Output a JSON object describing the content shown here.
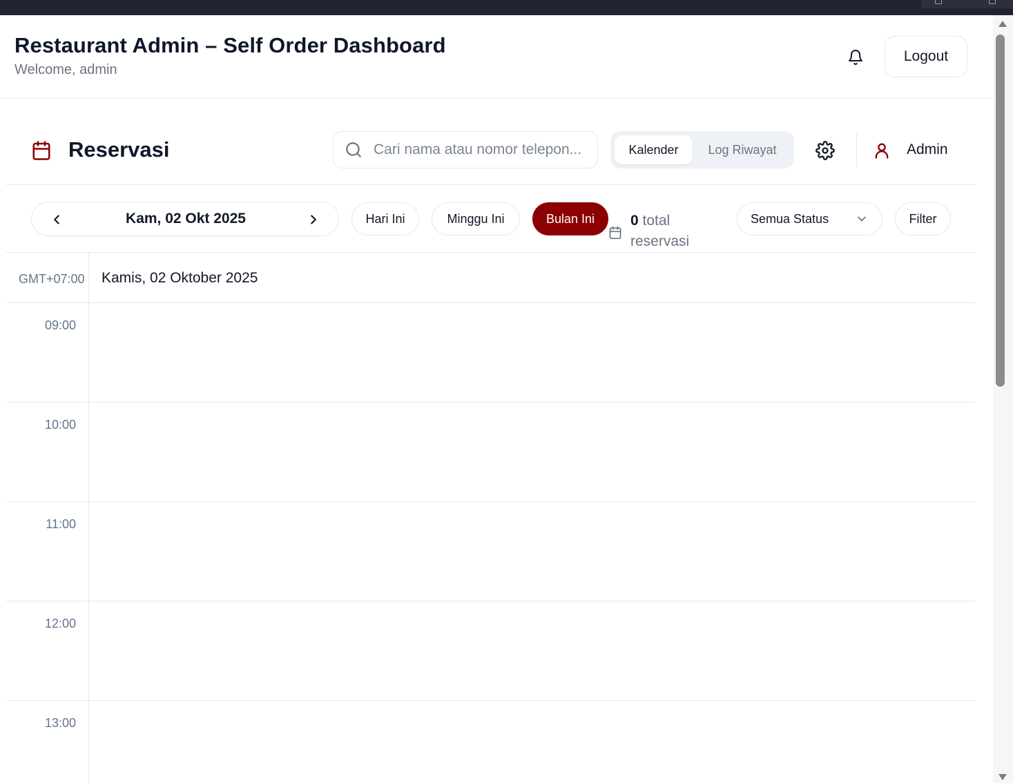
{
  "app": {
    "title": "Restaurant Admin – Self Order Dashboard",
    "subtitle": "Welcome, admin",
    "logout_label": "Logout"
  },
  "toolbar": {
    "title": "Reservasi",
    "search_placeholder": "Cari nama atau nomor telepon...",
    "view_tabs": [
      "Kalender",
      "Log Riwayat"
    ],
    "active_view": "Kalender",
    "user_label": "Admin"
  },
  "controls": {
    "current_date": "Kam, 02 Okt 2025",
    "quick_ranges": [
      "Hari Ini",
      "Minggu Ini",
      "Bulan Ini"
    ],
    "active_range": "Bulan Ini",
    "total_count": "0",
    "total_text": "total reservasi",
    "status_value": "Semua Status",
    "filter_label": "Filter"
  },
  "calendar": {
    "timezone": "GMT+07:00",
    "day_heading": "Kamis, 02 Oktober 2025",
    "hours": [
      "09:00",
      "10:00",
      "11:00",
      "12:00",
      "13:00"
    ]
  },
  "colors": {
    "accent": "#8b0000",
    "muted_text": "#6b7280",
    "border": "#e5e7eb"
  }
}
